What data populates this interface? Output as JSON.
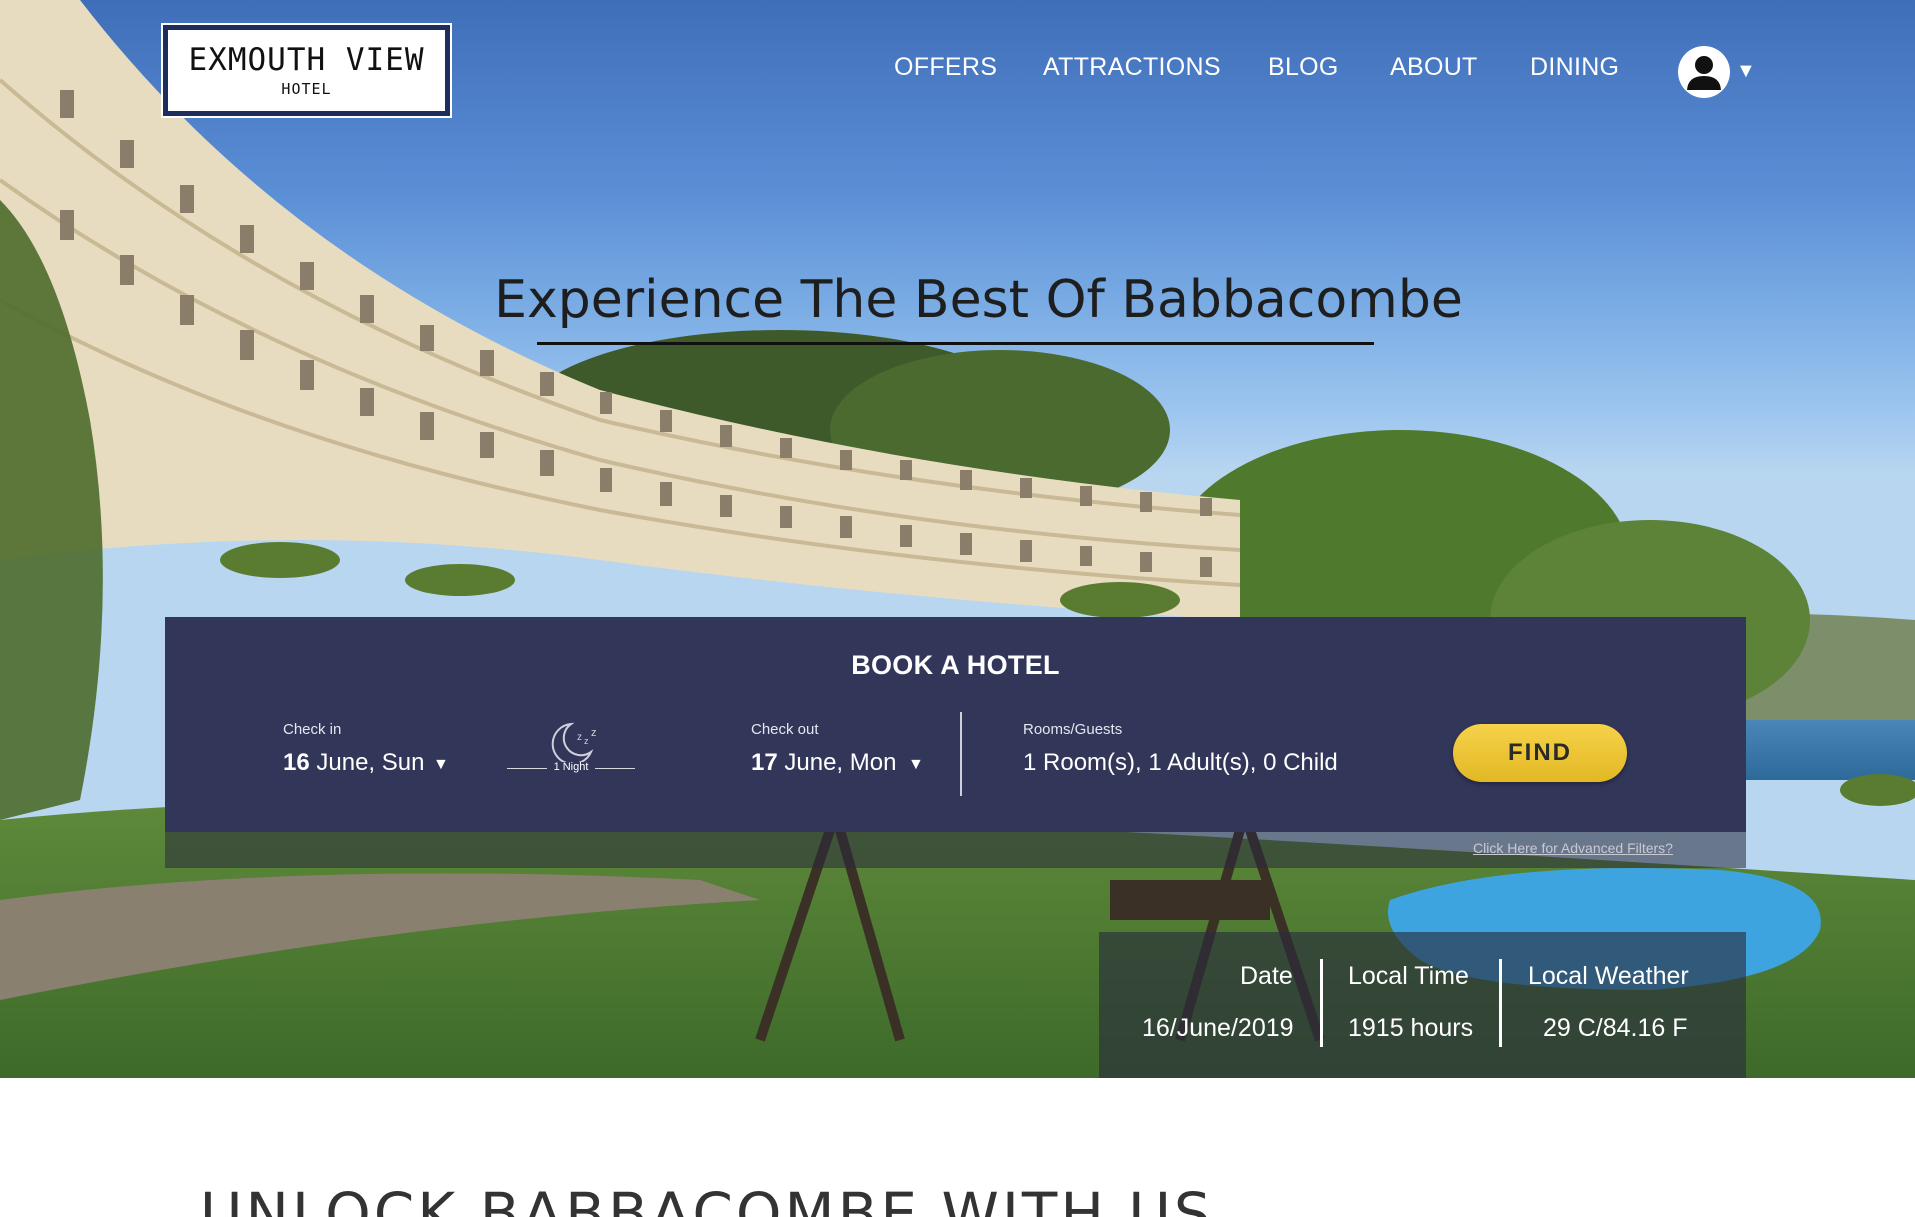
{
  "brand": {
    "name": "EXMOUTH VIEW",
    "sub": "HOTEL"
  },
  "nav": {
    "items": [
      "OFFERS",
      "ATTRACTIONS",
      "BLOG",
      "ABOUT",
      "DINING"
    ]
  },
  "hero": {
    "headline": "Experience The Best Of Babbacombe"
  },
  "booking": {
    "title": "BOOK A HOTEL",
    "checkin_label": "Check in",
    "checkin_day": "16",
    "checkin_rest": " June, Sun",
    "nights_label": "1 Night",
    "checkout_label": "Check out",
    "checkout_day": "17",
    "checkout_rest": " June, Mon",
    "rooms_label": "Rooms/Guests",
    "rooms_value": "1 Room(s), 1 Adult(s), 0 Child",
    "find_label": "FIND",
    "advanced_link": "Click Here for Advanced Filters?"
  },
  "info": {
    "date_label": "Date",
    "date_value": "16/June/2019",
    "time_label": "Local Time",
    "time_value": "1915 hours",
    "weather_label": "Local Weather",
    "weather_value": "29 C/84.16 F"
  },
  "section": {
    "title": "UNLOCK BABBACOMBE WITH US"
  },
  "colors": {
    "panel": "#323659",
    "find": "#f0c83a",
    "logo_border": "#1f2d5c"
  }
}
